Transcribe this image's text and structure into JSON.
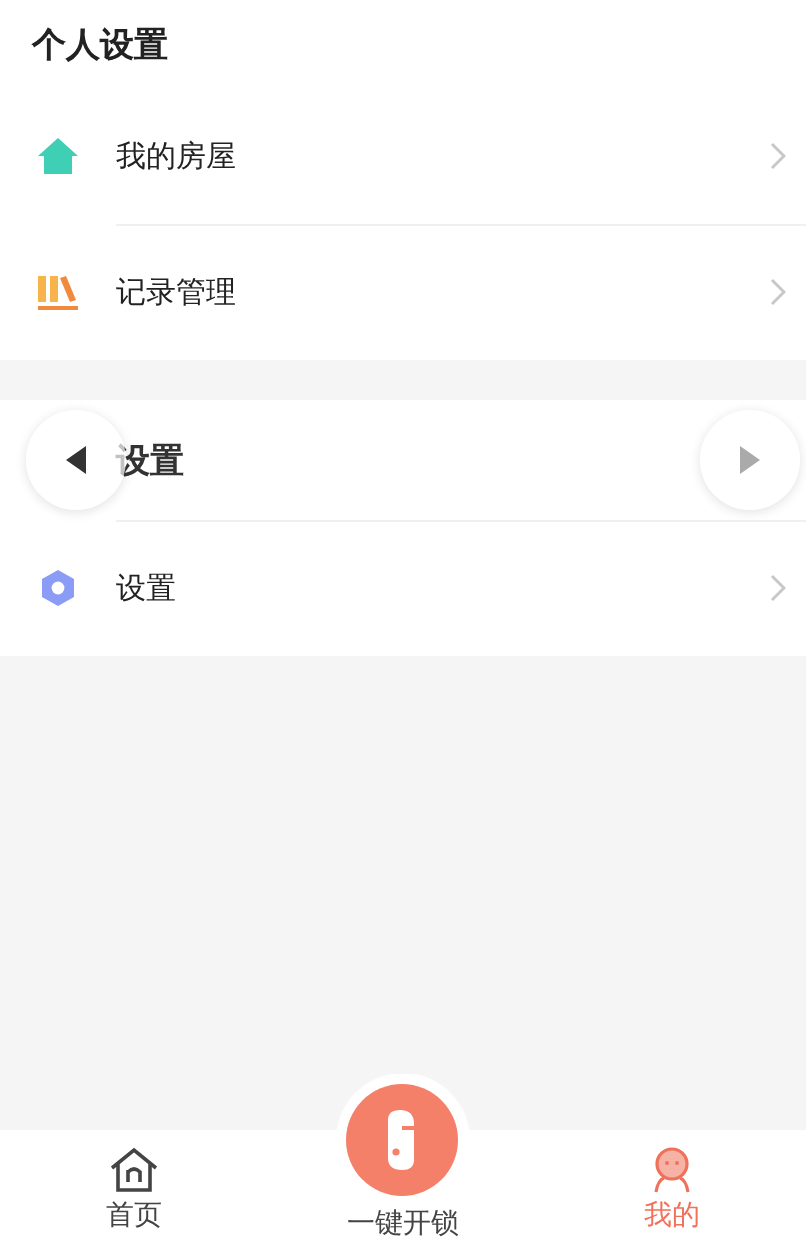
{
  "sections": [
    {
      "title": "个人设置",
      "items": [
        {
          "label": "我的房屋"
        },
        {
          "label": "记录管理"
        }
      ]
    },
    {
      "title": "设置",
      "items": [
        {
          "label": "设置"
        }
      ]
    }
  ],
  "tab_bar": [
    {
      "label": "首页",
      "kind": "home",
      "selected": false
    },
    {
      "label": "一键开锁",
      "kind": "unlock",
      "selected": false
    },
    {
      "label": "我的",
      "kind": "me",
      "selected": true
    }
  ]
}
